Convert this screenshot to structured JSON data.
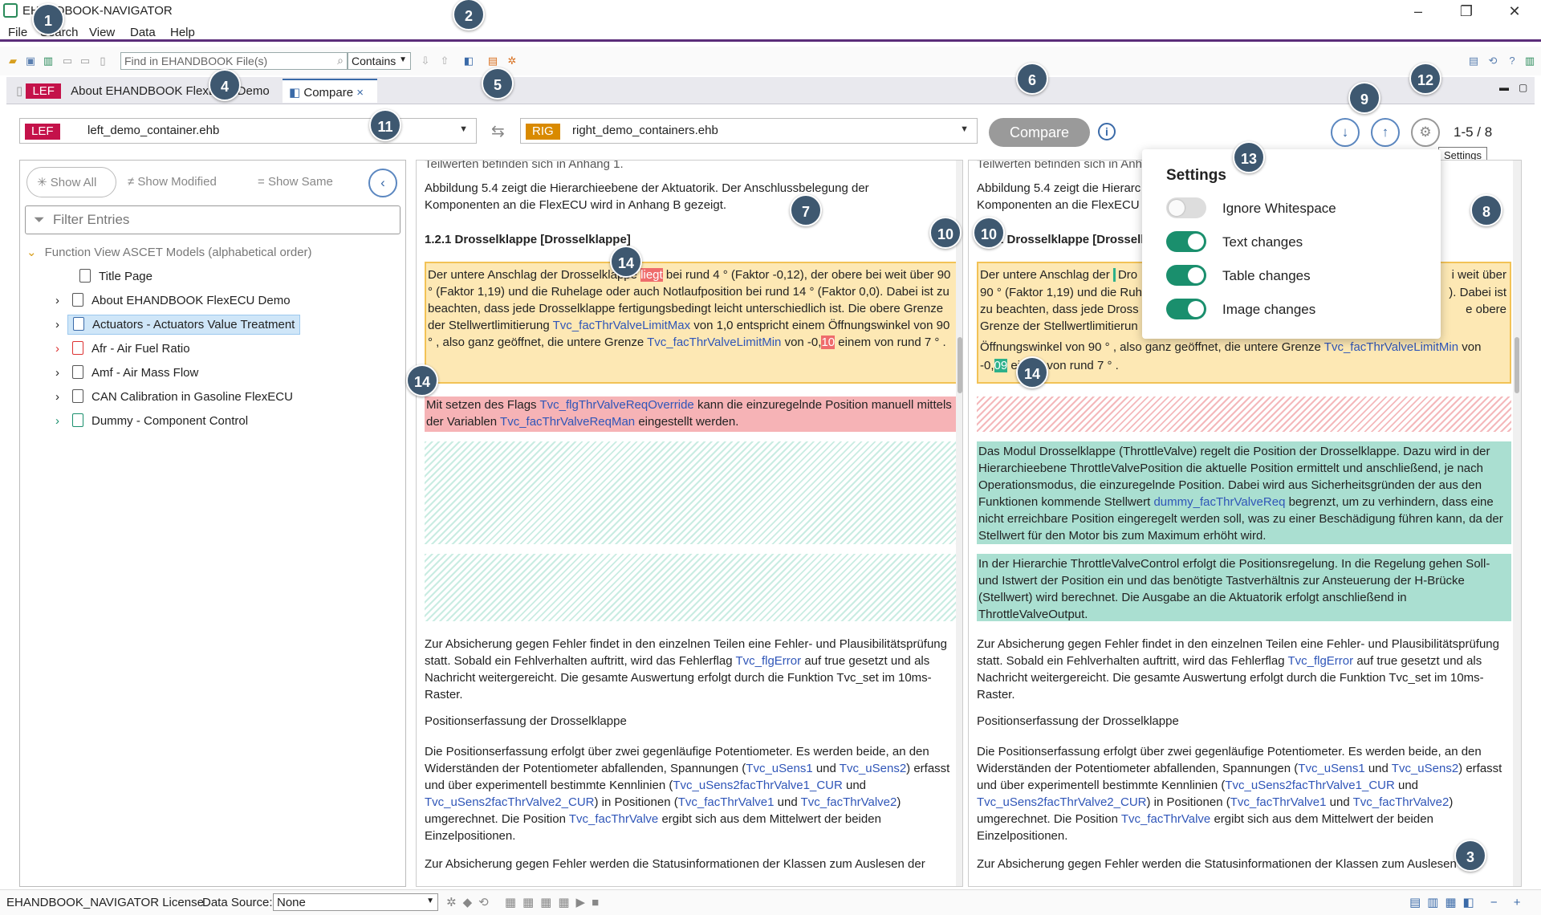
{
  "window": {
    "title": "EHANDBOOK-NAVIGATOR"
  },
  "menu": [
    "File",
    "Search",
    "View",
    "Data",
    "Help"
  ],
  "toolbar": {
    "find_placeholder": "Find in EHANDBOOK File(s)",
    "find_mode": "Contains"
  },
  "tabs": [
    {
      "badge": "LEF",
      "label": "About EHANDBOOK FlexECU Demo"
    },
    {
      "label": "Compare",
      "close": "×"
    }
  ],
  "compare": {
    "left": {
      "badge": "LEF",
      "file": "left_demo_container.ehb"
    },
    "right": {
      "badge": "RIG",
      "file": "right_demo_containers.ehb"
    },
    "compare_label": "Compare",
    "counter": "1-5 / 8",
    "tooltip": "Settings"
  },
  "filters": {
    "show_all": "Show All",
    "show_modified": "Show Modified",
    "show_same": "Show Same",
    "filter_placeholder": "Filter Entries"
  },
  "tree": {
    "root": "Function View ASCET Models (alphabetical order)",
    "items": [
      {
        "label": "Title Page"
      },
      {
        "label": "About EHANDBOOK FlexECU Demo"
      },
      {
        "label": "Actuators - Actuators Value Treatment"
      },
      {
        "label": "Afr - Air Fuel Ratio"
      },
      {
        "label": "Amf - Air Mass Flow"
      },
      {
        "label": "CAN Calibration in Gasoline FlexECU"
      },
      {
        "label": "Dummy - Component Control"
      }
    ]
  },
  "left_doc": {
    "top_cut": "Teilwerten befinden sich in Anhang 1.",
    "p1": "Abbildung 5.4 zeigt die Hierarchieebene der Aktuatorik. Der Anschlussbelegung der Komponenten an die FlexECU wird in Anhang B gezeigt.",
    "heading": "1.2.1 Drosselklappe [Drosselklappe]",
    "changed_a": "Der untere Anschlag der Drosselklappe",
    "changed_mark": "liegt",
    "changed_b": "bei rund 4 ° (Faktor -0,12), der obere bei weit über 90 ° (Faktor 1,19) und die Ruhelage oder auch Notlaufposition bei rund 14 ° (Faktor 0,0). Dabei ist zu beachten, dass jede Drosselklappe fertigungsbedingt leicht unterschiedlich ist. Die obere Grenze der Stellwertlimitierung",
    "link1": "Tvc_facThrValveLimitMax",
    "changed_c": "von 1,0 entspricht einem Öffnungswinkel von 90 ° , also ganz geöffnet, die untere Grenze",
    "link2": "Tvc_facThrValveLimitMin",
    "changed_d": "von -0,",
    "changed_mark2": "10",
    "changed_e": "einem von rund 7 ° .",
    "removed_a": "Mit setzen des Flags",
    "removed_link1": "Tvc_flgThrValveReqOverride",
    "removed_b": "kann die einzuregelnde Position manuell mittels der Variablen",
    "removed_link2": "Tvc_facThrValveReqMan",
    "removed_c": "eingestellt werden."
  },
  "right_doc": {
    "top_cut": "Teilwerten befinden sich in Anhang 1.",
    "p1a": "Abbildung 5.4 zeigt die Hierarc",
    "p1b": "Komponenten an die FlexECU w",
    "heading": "1.2.1 Drosselklappe [Drosselk",
    "changed_a": "Der untere Anschlag der",
    "changed_a2": "Dro",
    "changed_r1": "i weit über",
    "changed_b": "90 ° (Faktor 1,19) und die Ruhe",
    "changed_r2": "). Dabei ist",
    "changed_c": "zu beachten, dass jede Dross",
    "changed_r3": "e obere",
    "changed_d": "Grenze der Stellwertlimitierun",
    "changed_e": "Öffnungswinkel von 90 ° , also ganz geöffnet, die untere Grenze",
    "link2": "Tvc_facThrValveLimitMin",
    "changed_f": "von",
    "changed_g": "-0,",
    "changed_mark2": "09",
    "changed_h": "einem von rund 7 ° .",
    "added1_a": "Das Modul Drosselklappe (ThrottleValve) regelt die Position der Drosselklappe. Dazu wird in der Hierarchieebene ThrottleValvePosition die aktuelle Position ermittelt und anschließend, je nach Operationsmodus, die einzuregelnde Position. Dabei wird aus Sicherheitsgründen der aus den Funktionen kommende Stellwert",
    "added1_link": "dummy_facThrValveReq",
    "added1_b": "begrenzt, um zu verhindern, dass eine nicht erreichbare Position eingeregelt werden soll, was zu einer Beschädigung führen kann, da der Stellwert für den Motor bis zum Maximum erhöht wird.",
    "added2": "In der Hierarchie ThrottleValveControl erfolgt die Positionsregelung. In die Regelung gehen Soll- und Istwert der Position ein und das benötigte Tastverhältnis zur Ansteuerung der H-Brücke (Stellwert) wird berechnet. Die Ausgabe an die Aktuatorik erfolgt anschließend in ThrottleValveOutput."
  },
  "common": {
    "p_safety_a": "Zur Absicherung gegen Fehler findet in den einzelnen Teilen eine Fehler- und Plausibilitätsprüfung statt. Sobald ein Fehlverhalten auftritt, wird das Fehlerflag",
    "p_safety_link": "Tvc_flgError",
    "p_safety_b": "auf true gesetzt und als Nachricht weitergereicht. Die gesamte Auswertung erfolgt durch die Funktion Tvc_set im 10ms-Raster.",
    "sub": "Positionserfassung der Drosselklappe",
    "p_pos_a": "Die Positionserfassung erfolgt über zwei gegenläufige Potentiometer. Es werden beide, an den Widerständen der Potentiometer abfallenden, Spannungen (",
    "l_s1": "Tvc_uSens1",
    "und": "und",
    "l_s2": "Tvc_uSens2",
    "p_pos_b": ") erfasst und über experimentell bestimmte Kennlinien (",
    "l_c1": "Tvc_uSens2facThrValve1_CUR",
    "l_c2": "Tvc_uSens2facThrValve2_CUR",
    "p_pos_c": ") in Positionen (",
    "l_v1": "Tvc_facThrValve1",
    "l_v2": "Tvc_facThrValve2",
    "p_pos_d": ") umgerechnet. Die Position",
    "l_v": "Tvc_facThrValve",
    "p_pos_e": "ergibt sich aus dem Mittelwert der beiden Einzelpositionen.",
    "p_last": "Zur Absicherung gegen Fehler werden die Statusinformationen der Klassen zum Auslesen der",
    "p_last_r": "Zur Absicherung gegen Fehler werden die Statusinformationen der Klassen zum Auslesen"
  },
  "settings": {
    "title": "Settings",
    "options": [
      {
        "label": "Ignore Whitespace",
        "on": false
      },
      {
        "label": "Text changes",
        "on": true
      },
      {
        "label": "Table changes",
        "on": true
      },
      {
        "label": "Image changes",
        "on": true
      }
    ]
  },
  "callouts": [
    "1",
    "2",
    "3",
    "4",
    "5",
    "6",
    "7",
    "8",
    "9",
    "10",
    "10",
    "11",
    "12",
    "13",
    "14",
    "14",
    "14"
  ],
  "status": {
    "license": "EHANDBOOK_NAVIGATOR License",
    "source_label": "Data Source:",
    "source_value": "None"
  },
  "colors": {
    "accent": "#5b2d7a",
    "lef": "#c4124a",
    "rig": "#d98a00",
    "toggle_on": "#1a8f6d",
    "changed": "#fde8b4",
    "removed": "#f6b3b6",
    "added": "#aadfd1",
    "callout": "#3e5870"
  }
}
